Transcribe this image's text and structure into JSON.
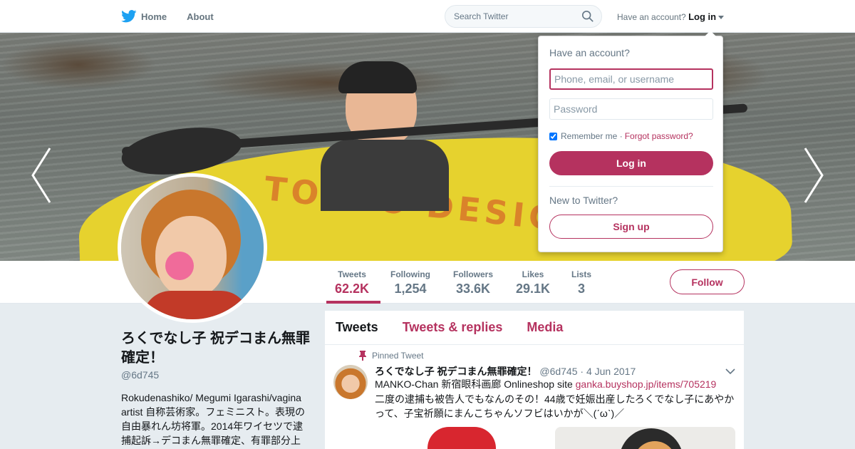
{
  "nav": {
    "home_label": "Home",
    "about_label": "About",
    "search_placeholder": "Search Twitter",
    "have_account_text": "Have an account?",
    "login_label": "Log in"
  },
  "stats": {
    "tweets": {
      "label": "Tweets",
      "value": "62.2K"
    },
    "following": {
      "label": "Following",
      "value": "1,254"
    },
    "followers": {
      "label": "Followers",
      "value": "33.6K"
    },
    "likes": {
      "label": "Likes",
      "value": "29.1K"
    },
    "lists": {
      "label": "Lists",
      "value": "3"
    },
    "follow_label": "Follow"
  },
  "profile": {
    "name": "ろくでなし子 祝デコまん無罪確定！",
    "handle": "@6d745",
    "bio": "Rokudenashiko/ Megumi Igarashi/vagina artist 自称芸術家。フェミニスト。表現の自由暴れん坊将軍。2014年ワイセツで逮捕起訴→デコまん無罪確定、有罪部分上"
  },
  "timeline": {
    "tabs": [
      "Tweets",
      "Tweets & replies",
      "Media"
    ],
    "pinned_label": "Pinned Tweet",
    "tweet": {
      "author": "ろくでなし子 祝デコまん無罪確定！",
      "handle": "@6d745",
      "date": "· 4 Jun 2017",
      "line1_text": "MANKO-Chan 新宿眼科画廊 Onlineshop site ",
      "line1_link": "ganka.buyshop.jp/items/705219",
      "line2": "二度の逮捕も被告人でもなんのその！44歳で妊娠出産したろくでなし子にあやか",
      "line3": "って、子宝祈願にまんこちゃんソフビはいかが＼(ˊωˋ)／"
    }
  },
  "login_popup": {
    "title": "Have an account?",
    "username_placeholder": "Phone, email, or username",
    "password_placeholder": "Password",
    "remember_label": "Remember me ·",
    "forgot_label": "Forgot password?",
    "login_button": "Log in",
    "new_text": "New to Twitter?",
    "signup_button": "Sign up"
  },
  "colors": {
    "accent": "#b5325f",
    "twitter_blue": "#1da1f2",
    "background": "#e6ecf0"
  },
  "icons": {
    "logo": "twitter-bird-icon",
    "search": "search-icon",
    "pin": "pin-icon",
    "prev": "chevron-left-icon",
    "next": "chevron-right-icon"
  }
}
